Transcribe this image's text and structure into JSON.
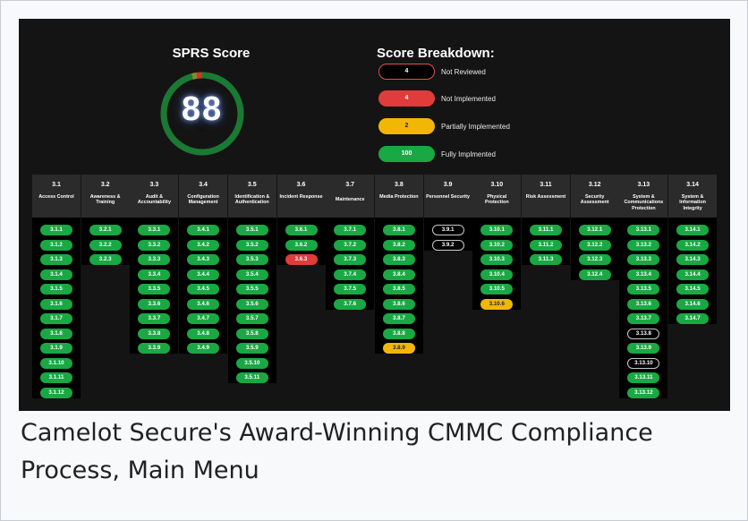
{
  "caption": "Camelot Secure's Award-Winning CMMC Compliance Process, Main Menu",
  "sprs": {
    "title": "SPRS Score",
    "score": "88",
    "gauge_fill_fraction": 0.97,
    "gauge_color": "#1a7a34"
  },
  "breakdown": {
    "title": "Score Breakdown:",
    "items": [
      {
        "count": "4",
        "label": "Not Reviewed",
        "status": "review"
      },
      {
        "count": "4",
        "label": "Not Implemented",
        "status": "none"
      },
      {
        "count": "2",
        "label": "Partially Implemented",
        "status": "partial"
      },
      {
        "count": "100",
        "label": "Fully Implmented",
        "status": "full"
      }
    ]
  },
  "colors": {
    "full": "#1aa844",
    "none": "#e03c3c",
    "partial": "#f2b705",
    "review": "#000000",
    "background": "#141414"
  },
  "families": [
    {
      "num": "3.1",
      "name": "Access Control",
      "controls": [
        {
          "id": "3.1.1",
          "status": "full"
        },
        {
          "id": "3.1.2",
          "status": "full"
        },
        {
          "id": "3.1.3",
          "status": "full"
        },
        {
          "id": "3.1.4",
          "status": "full"
        },
        {
          "id": "3.1.5",
          "status": "full"
        },
        {
          "id": "3.1.6",
          "status": "full"
        },
        {
          "id": "3.1.7",
          "status": "full"
        },
        {
          "id": "3.1.8",
          "status": "full"
        },
        {
          "id": "3.1.9",
          "status": "full"
        },
        {
          "id": "3.1.10",
          "status": "full"
        },
        {
          "id": "3.1.11",
          "status": "full"
        },
        {
          "id": "3.1.12",
          "status": "full"
        }
      ]
    },
    {
      "num": "3.2",
      "name": "Awareness & Training",
      "controls": [
        {
          "id": "3.2.1",
          "status": "full"
        },
        {
          "id": "3.2.2",
          "status": "full"
        },
        {
          "id": "3.2.3",
          "status": "full"
        }
      ]
    },
    {
      "num": "3.3",
      "name": "Audit & Accountability",
      "controls": [
        {
          "id": "3.3.1",
          "status": "full"
        },
        {
          "id": "3.3.2",
          "status": "full"
        },
        {
          "id": "3.3.3",
          "status": "full"
        },
        {
          "id": "3.3.4",
          "status": "full"
        },
        {
          "id": "3.3.5",
          "status": "full"
        },
        {
          "id": "3.3.6",
          "status": "full"
        },
        {
          "id": "3.3.7",
          "status": "full"
        },
        {
          "id": "3.3.8",
          "status": "full"
        },
        {
          "id": "3.3.9",
          "status": "full"
        }
      ]
    },
    {
      "num": "3.4",
      "name": "Configuration Management",
      "controls": [
        {
          "id": "3.4.1",
          "status": "full"
        },
        {
          "id": "3.4.2",
          "status": "full"
        },
        {
          "id": "3.4.3",
          "status": "full"
        },
        {
          "id": "3.4.4",
          "status": "full"
        },
        {
          "id": "3.4.5",
          "status": "full"
        },
        {
          "id": "3.4.6",
          "status": "full"
        },
        {
          "id": "3.4.7",
          "status": "full"
        },
        {
          "id": "3.4.8",
          "status": "full"
        },
        {
          "id": "3.4.9",
          "status": "full"
        }
      ]
    },
    {
      "num": "3.5",
      "name": "Identification & Authentication",
      "controls": [
        {
          "id": "3.5.1",
          "status": "full"
        },
        {
          "id": "3.5.2",
          "status": "full"
        },
        {
          "id": "3.5.3",
          "status": "full"
        },
        {
          "id": "3.5.4",
          "status": "full"
        },
        {
          "id": "3.5.5",
          "status": "full"
        },
        {
          "id": "3.5.6",
          "status": "full"
        },
        {
          "id": "3.5.7",
          "status": "full"
        },
        {
          "id": "3.5.8",
          "status": "full"
        },
        {
          "id": "3.5.9",
          "status": "full"
        },
        {
          "id": "3.5.10",
          "status": "full"
        },
        {
          "id": "3.5.11",
          "status": "full"
        }
      ]
    },
    {
      "num": "3.6",
      "name": "Incident Response",
      "controls": [
        {
          "id": "3.6.1",
          "status": "full"
        },
        {
          "id": "3.6.2",
          "status": "full"
        },
        {
          "id": "3.6.3",
          "status": "none"
        }
      ]
    },
    {
      "num": "3.7",
      "name": "Maintenance",
      "controls": [
        {
          "id": "3.7.1",
          "status": "full"
        },
        {
          "id": "3.7.2",
          "status": "full"
        },
        {
          "id": "3.7.3",
          "status": "full"
        },
        {
          "id": "3.7.4",
          "status": "full"
        },
        {
          "id": "3.7.5",
          "status": "full"
        },
        {
          "id": "3.7.6",
          "status": "full"
        }
      ]
    },
    {
      "num": "3.8",
      "name": "Media Protection",
      "controls": [
        {
          "id": "3.8.1",
          "status": "full"
        },
        {
          "id": "3.8.2",
          "status": "full"
        },
        {
          "id": "3.8.3",
          "status": "full"
        },
        {
          "id": "3.8.4",
          "status": "full"
        },
        {
          "id": "3.8.5",
          "status": "full"
        },
        {
          "id": "3.8.6",
          "status": "full"
        },
        {
          "id": "3.8.7",
          "status": "full"
        },
        {
          "id": "3.8.8",
          "status": "full"
        },
        {
          "id": "3.8.9",
          "status": "partial"
        }
      ]
    },
    {
      "num": "3.9",
      "name": "Personnel Security",
      "controls": [
        {
          "id": "3.9.1",
          "status": "review"
        },
        {
          "id": "3.9.2",
          "status": "review"
        }
      ]
    },
    {
      "num": "3.10",
      "name": "Physical Protection",
      "controls": [
        {
          "id": "3.10.1",
          "status": "full"
        },
        {
          "id": "3.10.2",
          "status": "full"
        },
        {
          "id": "3.10.3",
          "status": "full"
        },
        {
          "id": "3.10.4",
          "status": "full"
        },
        {
          "id": "3.10.5",
          "status": "full"
        },
        {
          "id": "3.10.6",
          "status": "partial"
        }
      ]
    },
    {
      "num": "3.11",
      "name": "Risk Assessment",
      "controls": [
        {
          "id": "3.11.1",
          "status": "full"
        },
        {
          "id": "3.11.2",
          "status": "full"
        },
        {
          "id": "3.11.3",
          "status": "full"
        }
      ]
    },
    {
      "num": "3.12",
      "name": "Security Assessment",
      "controls": [
        {
          "id": "3.12.1",
          "status": "full"
        },
        {
          "id": "3.12.2",
          "status": "full"
        },
        {
          "id": "3.12.3",
          "status": "full"
        },
        {
          "id": "3.12.4",
          "status": "full"
        }
      ]
    },
    {
      "num": "3.13",
      "name": "System & Communications Protection",
      "controls": [
        {
          "id": "3.13.1",
          "status": "full"
        },
        {
          "id": "3.13.2",
          "status": "full"
        },
        {
          "id": "3.13.3",
          "status": "full"
        },
        {
          "id": "3.13.4",
          "status": "full"
        },
        {
          "id": "3.13.5",
          "status": "full"
        },
        {
          "id": "3.13.6",
          "status": "full"
        },
        {
          "id": "3.13.7",
          "status": "full"
        },
        {
          "id": "3.13.8",
          "status": "review"
        },
        {
          "id": "3.13.9",
          "status": "full"
        },
        {
          "id": "3.13.10",
          "status": "review"
        },
        {
          "id": "3.13.11",
          "status": "full"
        },
        {
          "id": "3.13.12",
          "status": "full"
        }
      ]
    },
    {
      "num": "3.14",
      "name": "System & Information Integrity",
      "controls": [
        {
          "id": "3.14.1",
          "status": "full"
        },
        {
          "id": "3.14.2",
          "status": "full"
        },
        {
          "id": "3.14.3",
          "status": "full"
        },
        {
          "id": "3.14.4",
          "status": "full"
        },
        {
          "id": "3.14.5",
          "status": "full"
        },
        {
          "id": "3.14.6",
          "status": "full"
        },
        {
          "id": "3.14.7",
          "status": "full"
        }
      ]
    }
  ]
}
